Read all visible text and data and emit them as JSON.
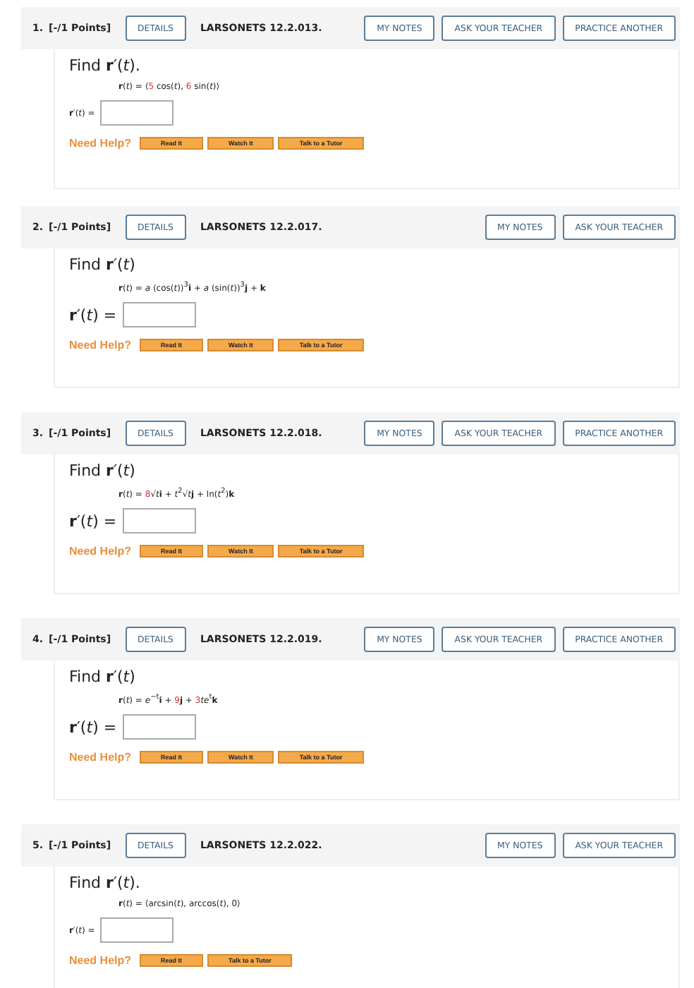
{
  "problems": [
    {
      "number": "1.",
      "points": "[-/1 Points]",
      "details": "DETAILS",
      "code": "LARSONETS 12.2.013.",
      "actions": [
        "MY NOTES",
        "ASK YOUR TEACHER",
        "PRACTICE ANOTHER"
      ],
      "prompt": "Find **r**′(*t*).",
      "formula": [
        {
          "text": "**r**(*t*) = ⟨",
          "highlight": false
        },
        {
          "text": "5",
          "highlight": true
        },
        {
          "text": " cos(*t*), ",
          "highlight": false
        },
        {
          "text": "6",
          "highlight": true
        },
        {
          "text": " sin(*t*)⟩",
          "highlight": false
        }
      ],
      "answer_label": "**r**′(*t*) =",
      "compact": true,
      "help_label": "Need Help?",
      "help": [
        "Read It",
        "Watch It",
        "Talk to a Tutor"
      ]
    },
    {
      "number": "2.",
      "points": "[-/1 Points]",
      "details": "DETAILS",
      "code": "LARSONETS 12.2.017.",
      "actions": [
        "MY NOTES",
        "ASK YOUR TEACHER"
      ],
      "prompt": "Find **r**′(*t*)",
      "formula": [
        {
          "text": "**r**(*t*) = *a* (cos(*t*))$^{3}$**i** + *a* (sin(*t*))$^{3}$**j** + **k**",
          "highlight": false
        }
      ],
      "answer_label": "**r**′(*t*) =",
      "compact": false,
      "help_label": "Need Help?",
      "help": [
        "Read It",
        "Watch It",
        "Talk to a Tutor"
      ]
    },
    {
      "number": "3.",
      "points": "[-/1 Points]",
      "details": "DETAILS",
      "code": "LARSONETS 12.2.018.",
      "actions": [
        "MY NOTES",
        "ASK YOUR TEACHER",
        "PRACTICE ANOTHER"
      ],
      "prompt": "Find **r**′(*t*)",
      "formula": [
        {
          "text": "**r**(*t*) = ",
          "highlight": false
        },
        {
          "text": "8",
          "highlight": true
        },
        {
          "text": "√*t*",
          "highlight": false
        },
        {
          "text": "**i** + *t*$^{2}$√*t*",
          "highlight": false
        },
        {
          "text": "**j** + ln(*t*$^{2}$)**k**",
          "highlight": false
        }
      ],
      "answer_label": "**r**′(*t*) =",
      "compact": false,
      "help_label": "Need Help?",
      "help": [
        "Read It",
        "Watch It",
        "Talk to a Tutor"
      ]
    },
    {
      "number": "4.",
      "points": "[-/1 Points]",
      "details": "DETAILS",
      "code": "LARSONETS 12.2.019.",
      "actions": [
        "MY NOTES",
        "ASK YOUR TEACHER",
        "PRACTICE ANOTHER"
      ],
      "prompt": "Find **r**′(*t*)",
      "formula": [
        {
          "text": "**r**(*t*) = *e*$^{−t}$**i** + ",
          "highlight": false
        },
        {
          "text": "9",
          "highlight": true
        },
        {
          "text": "**j** + ",
          "highlight": false
        },
        {
          "text": "3",
          "highlight": true
        },
        {
          "text": "*te*$^{t}$**k**",
          "highlight": false
        }
      ],
      "answer_label": "**r**′(*t*) =",
      "compact": false,
      "help_label": "Need Help?",
      "help": [
        "Read It",
        "Watch It",
        "Talk to a Tutor"
      ]
    },
    {
      "number": "5.",
      "points": "[-/1 Points]",
      "details": "DETAILS",
      "code": "LARSONETS 12.2.022.",
      "actions": [
        "MY NOTES",
        "ASK YOUR TEACHER"
      ],
      "prompt": "Find **r**′(*t*).",
      "formula": [
        {
          "text": "**r**(*t*) = ⟨arcsin(*t*), arccos(*t*), 0⟩",
          "highlight": false
        }
      ],
      "answer_label": "**r**′(*t*) =",
      "compact": true,
      "help_label": "Need Help?",
      "help": [
        "Read It",
        "Talk to a Tutor"
      ]
    }
  ]
}
